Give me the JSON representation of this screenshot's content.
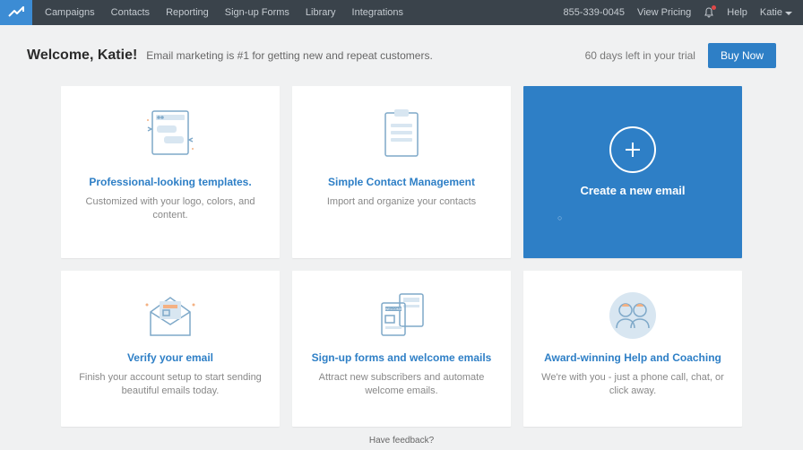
{
  "nav": {
    "items": [
      "Campaigns",
      "Contacts",
      "Reporting",
      "Sign-up Forms",
      "Library",
      "Integrations"
    ],
    "phone": "855-339-0045",
    "pricing": "View Pricing",
    "help": "Help",
    "user": "Katie"
  },
  "banner": {
    "welcome": "Welcome, Katie!",
    "tagline": "Email marketing is #1 for getting new and repeat customers.",
    "trial": "60 days left in your trial",
    "buy": "Buy Now"
  },
  "cards": {
    "templates": {
      "title": "Professional-looking templates.",
      "desc": "Customized with your logo, colors, and content."
    },
    "contacts": {
      "title": "Simple Contact Management",
      "desc": "Import and organize your contacts"
    },
    "create": {
      "title": "Create a new email"
    },
    "verify": {
      "title": "Verify your email",
      "desc": "Finish your account setup to start sending beautiful emails today."
    },
    "signup": {
      "title": "Sign-up forms and welcome emails",
      "desc": "Attract new subscribers and automate welcome emails."
    },
    "coaching": {
      "title": "Award-winning Help and Coaching",
      "desc": "We're with you - just a phone call, chat, or click away."
    }
  },
  "footer": {
    "feedback": "Have feedback?"
  }
}
